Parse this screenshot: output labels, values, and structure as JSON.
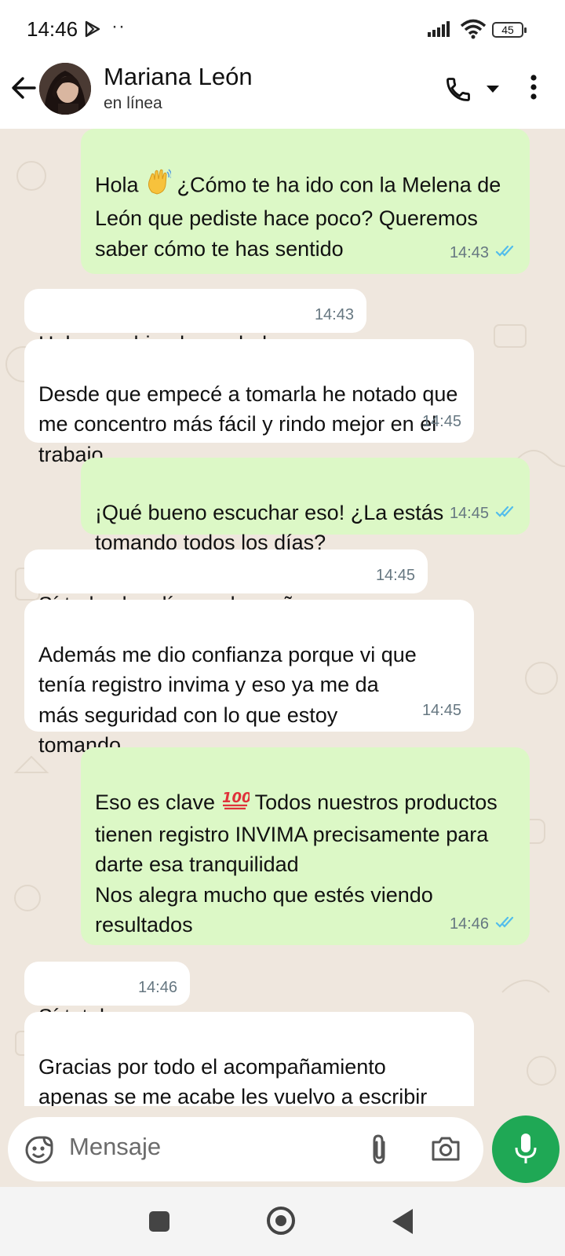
{
  "status_bar": {
    "time": "14:46",
    "dots": "··",
    "battery": "45"
  },
  "header": {
    "name": "Mariana León",
    "status": "en línea"
  },
  "messages": [
    {
      "dir": "out",
      "text_a": "Hola ",
      "text_b": " ¿Cómo te ha ido con la Melena de León que pediste hace poco? Queremos saber cómo te has sentido",
      "time": "14:43",
      "read": true
    },
    {
      "dir": "in",
      "text": "Hola muy bien la verdad",
      "time": "14:43"
    },
    {
      "dir": "in",
      "text": "Desde que empecé a tomarla he notado que me concentro más fácil y rindo mejor en el trabajo",
      "time": "14:45"
    },
    {
      "dir": "out",
      "text": "¡Qué bueno escuchar eso! ¿La estás tomando todos los días?",
      "time": "14:45",
      "read": true
    },
    {
      "dir": "in",
      "text": "Sí todos los días en la mañana",
      "time": "14:45"
    },
    {
      "dir": "in",
      "text": "Además me dio confianza porque vi que tenía registro invima y eso ya me da más seguridad con lo que estoy tomando",
      "time": "14:45"
    },
    {
      "dir": "out",
      "text_a": "Eso es clave ",
      "text_b": " Todos nuestros productos tienen registro INVIMA precisamente para darte esa tranquilidad\nNos alegra mucho que estés viendo resultados",
      "time": "14:46",
      "read": true
    },
    {
      "dir": "in",
      "text": "Sí total",
      "time": "14:46"
    },
    {
      "dir": "in",
      "text": "Gracias por todo el acompañamiento apenas se me acabe les vuelvo a escribir",
      "time": ""
    }
  ],
  "composer": {
    "placeholder": "Mensaje"
  },
  "colors": {
    "outgoing_bubble": "#dcf8c6",
    "incoming_bubble": "#ffffff",
    "read_tick": "#53bdeb",
    "mic_button": "#1fa855"
  },
  "icons": [
    "back-arrow-icon",
    "phone-icon",
    "caret-down-icon",
    "more-vert-icon",
    "emoji-icon",
    "attach-icon",
    "camera-icon",
    "mic-icon",
    "double-check-icon",
    "waving-hand-emoji",
    "smile-emoji",
    "hundred-points-emoji"
  ]
}
